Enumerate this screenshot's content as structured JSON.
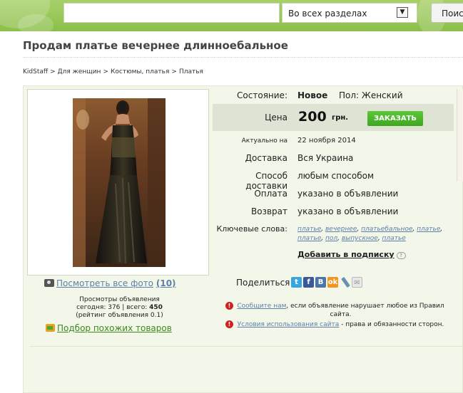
{
  "header": {
    "search_placeholder": "",
    "section_select": "Во всех разделах",
    "search_button": "Поиск",
    "bg_color": "#96c656"
  },
  "page_title": "Продам платье вечернее длинноебальное",
  "breadcrumb": [
    "KidStaff",
    "Для женщин",
    "Костюмы, платья",
    "Платья"
  ],
  "details": {
    "condition_label": "Состояние:",
    "condition_value": "Новое",
    "gender": "Пол: Женский",
    "price_label": "Цена",
    "price_value": "200",
    "price_currency": "грн.",
    "order_button": "ЗАКАЗАТЬ",
    "actual_label": "Актуально на",
    "actual_value": "22 ноября 2014",
    "delivery_label": "Доставка",
    "delivery_value": "Вся Украина",
    "delivery_method_label": "Способ доставки",
    "delivery_method_value": "любым способом",
    "payment_label": "Оплата",
    "payment_value": "указано в объявлении",
    "return_label": "Возврат",
    "return_value": "указано в объявлении",
    "keywords_label": "Ключевые слова:",
    "keywords": [
      "платье",
      "вечернее",
      "платьебальное",
      "платье",
      "платье",
      "пол",
      "выпускное",
      "платье"
    ],
    "subscribe": "Добавить в подписку"
  },
  "photo": {
    "see_all": "Посмотреть все фото",
    "count": "(10)"
  },
  "views": {
    "line1": "Просмотры объявления",
    "today_label": "сегодня:",
    "today": "376",
    "total_label": "всего:",
    "total": "450",
    "rating": "(рейтинг объявления 0.1)"
  },
  "similar": "Подбор похожих товаров",
  "share": {
    "label": "Поделиться",
    "icons": [
      "twitter-icon",
      "facebook-icon",
      "vkontakte-icon",
      "odnoklassniki-icon",
      "livejournal-icon",
      "email-icon"
    ]
  },
  "notices": {
    "report_link": "Сообщите нам",
    "report_text": ", если объявление нарушает любое из Правил сайта.",
    "terms_link": "Условия использования сайта",
    "terms_text": " - права и обязанности сторон."
  }
}
